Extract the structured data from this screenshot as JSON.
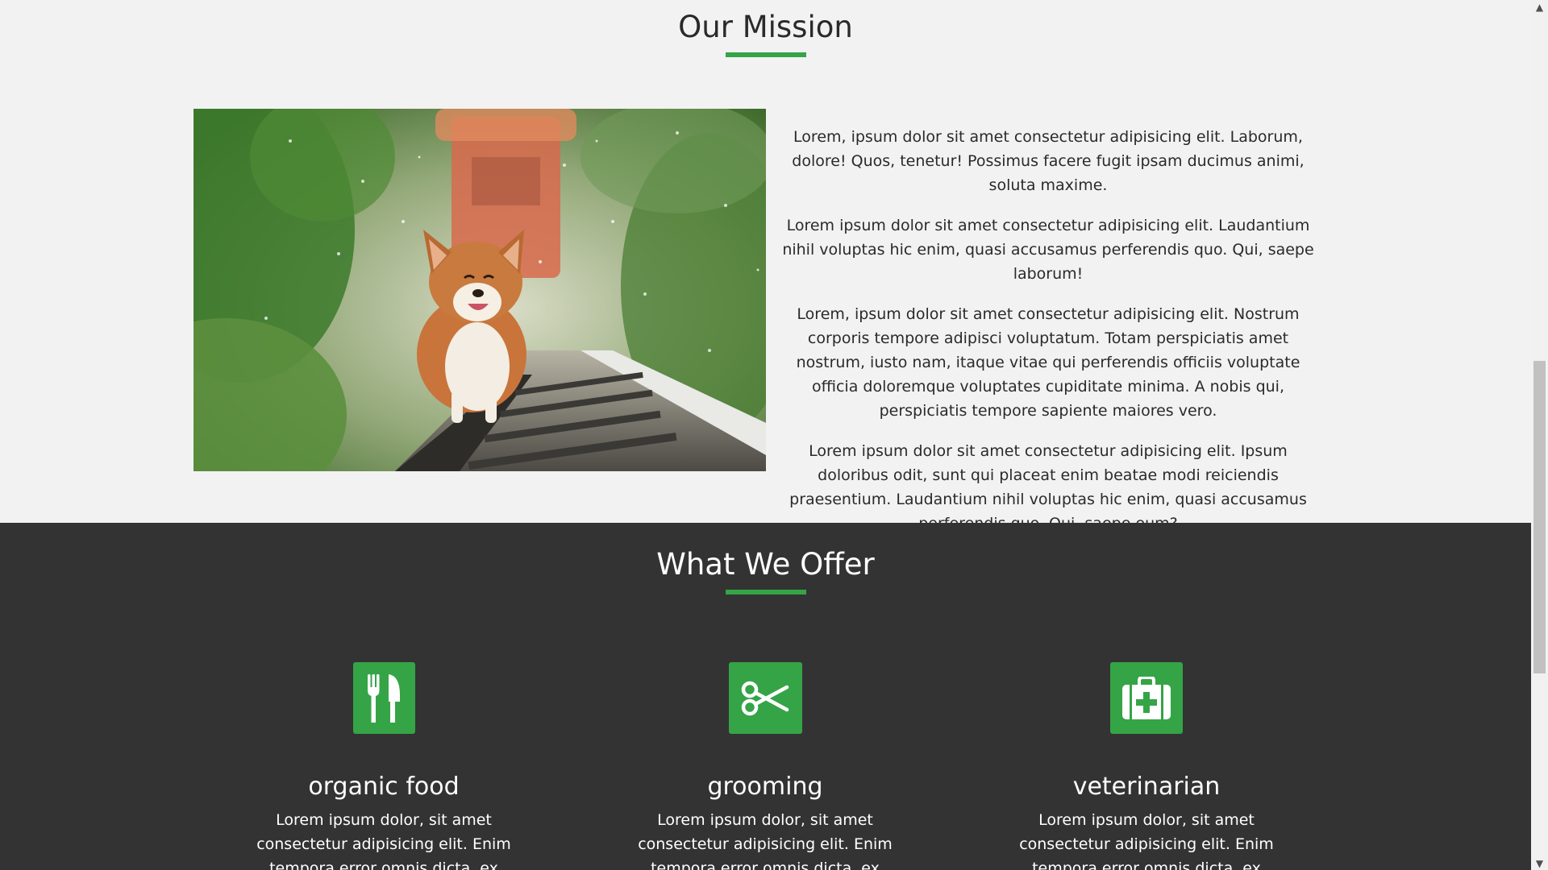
{
  "mission": {
    "title": "Our Mission",
    "paragraphs": [
      "Lorem, ipsum dolor sit amet consectetur adipisicing elit. Laborum, dolore! Quos, tenetur! Possimus facere fugit ipsam ducimus animi, soluta maxime.",
      "Lorem ipsum dolor sit amet consectetur adipisicing elit. Laudantium nihil voluptas hic enim, quasi accusamus perferendis quo. Qui, saepe laborum!",
      "Lorem, ipsum dolor sit amet consectetur adipisicing elit. Nostrum corporis tempore adipisci voluptatum. Totam perspiciatis amet nostrum, iusto nam, itaque vitae qui perferendis officiis voluptate officia doloremque voluptates cupiditate minima. A nobis qui, perspiciatis tempore sapiente maiores vero.",
      "Lorem ipsum dolor sit amet consectetur adipisicing elit. Ipsum doloribus odit, sunt qui placeat enim beatae modi reiciendis praesentium. Laudantium nihil voluptas hic enim, quasi accusamus perferendis quo. Qui, saepe eum?"
    ]
  },
  "offer": {
    "title": "What We Offer",
    "cards": [
      {
        "icon": "utensils-icon",
        "title": "organic food",
        "text": "Lorem ipsum dolor, sit amet consectetur adipisicing elit. Enim tempora error omnis dicta, ex incidunt."
      },
      {
        "icon": "scissors-icon",
        "title": "grooming",
        "text": "Lorem ipsum dolor, sit amet consectetur adipisicing elit. Enim tempora error omnis dicta, ex incidunt."
      },
      {
        "icon": "medkit-icon",
        "title": "veterinarian",
        "text": "Lorem ipsum dolor, sit amet consectetur adipisicing elit. Enim tempora error omnis dicta, ex incidunt."
      }
    ]
  },
  "colors": {
    "accent": "#35a446",
    "light_bg": "#f2f2f2",
    "dark_bg": "#333333"
  },
  "scrollbar": {
    "up_arrow": "▲",
    "down_arrow": "▼"
  }
}
